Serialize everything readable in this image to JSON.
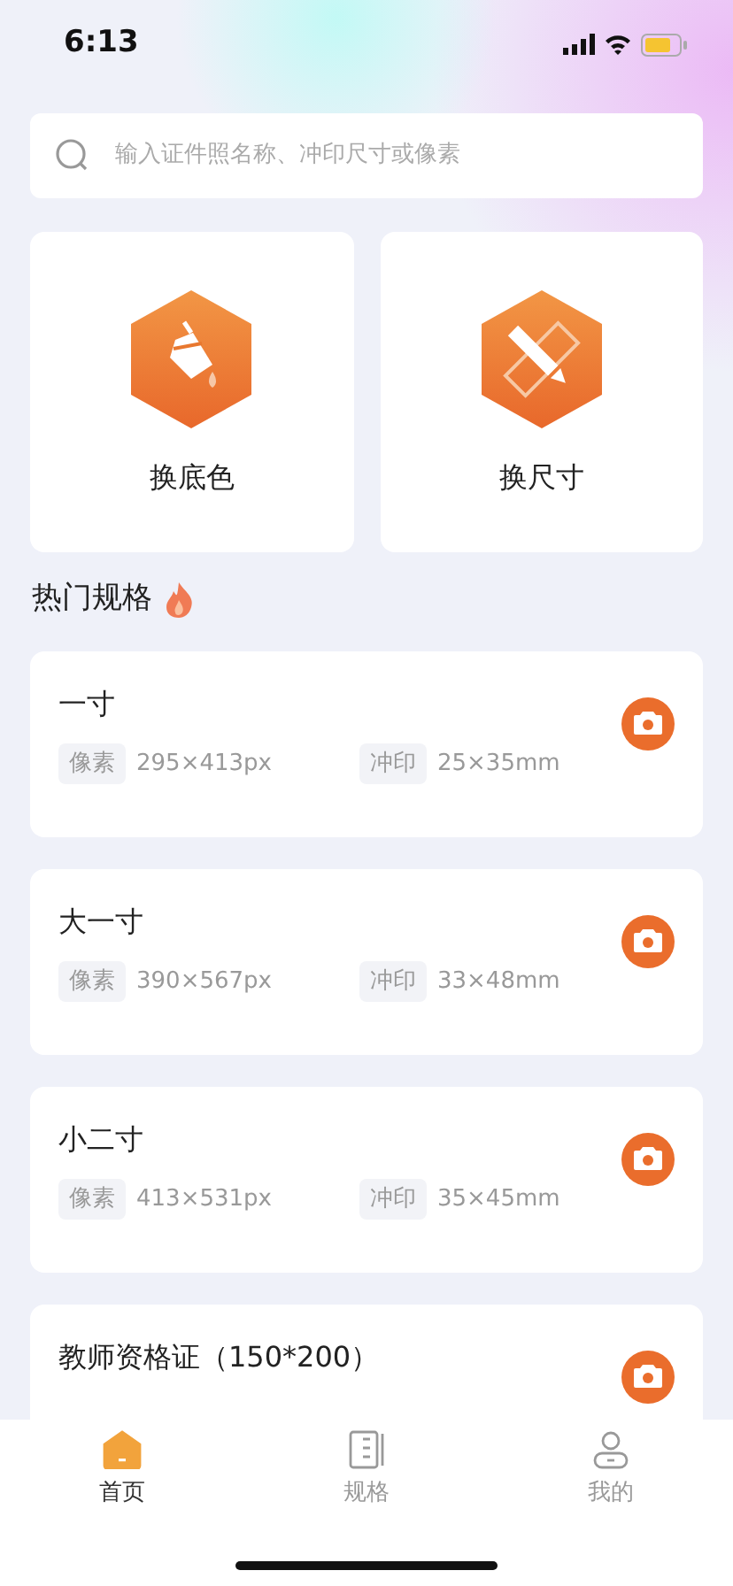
{
  "status_bar": {
    "time": "6:13"
  },
  "search": {
    "placeholder": "输入证件照名称、冲印尺寸或像素"
  },
  "tools": [
    {
      "kind": "bucket",
      "label": "换底色"
    },
    {
      "kind": "ruler",
      "label": "换尺寸"
    }
  ],
  "section_title": "热门规格",
  "specs": [
    {
      "name": "一寸",
      "pixel_label": "像素",
      "pixel": "295×413px",
      "print_label": "冲印",
      "print": "25×35mm"
    },
    {
      "name": "大一寸",
      "pixel_label": "像素",
      "pixel": "390×567px",
      "print_label": "冲印",
      "print": "33×48mm"
    },
    {
      "name": "小二寸",
      "pixel_label": "像素",
      "pixel": "413×531px",
      "print_label": "冲印",
      "print": "35×45mm"
    },
    {
      "name": "教师资格证（150*200）"
    }
  ],
  "tab_bar": [
    {
      "kind": "home",
      "label": "首页",
      "selected": true
    },
    {
      "kind": "spec",
      "label": "规格",
      "selected": false
    },
    {
      "kind": "user",
      "label": "我的",
      "selected": false
    }
  ]
}
